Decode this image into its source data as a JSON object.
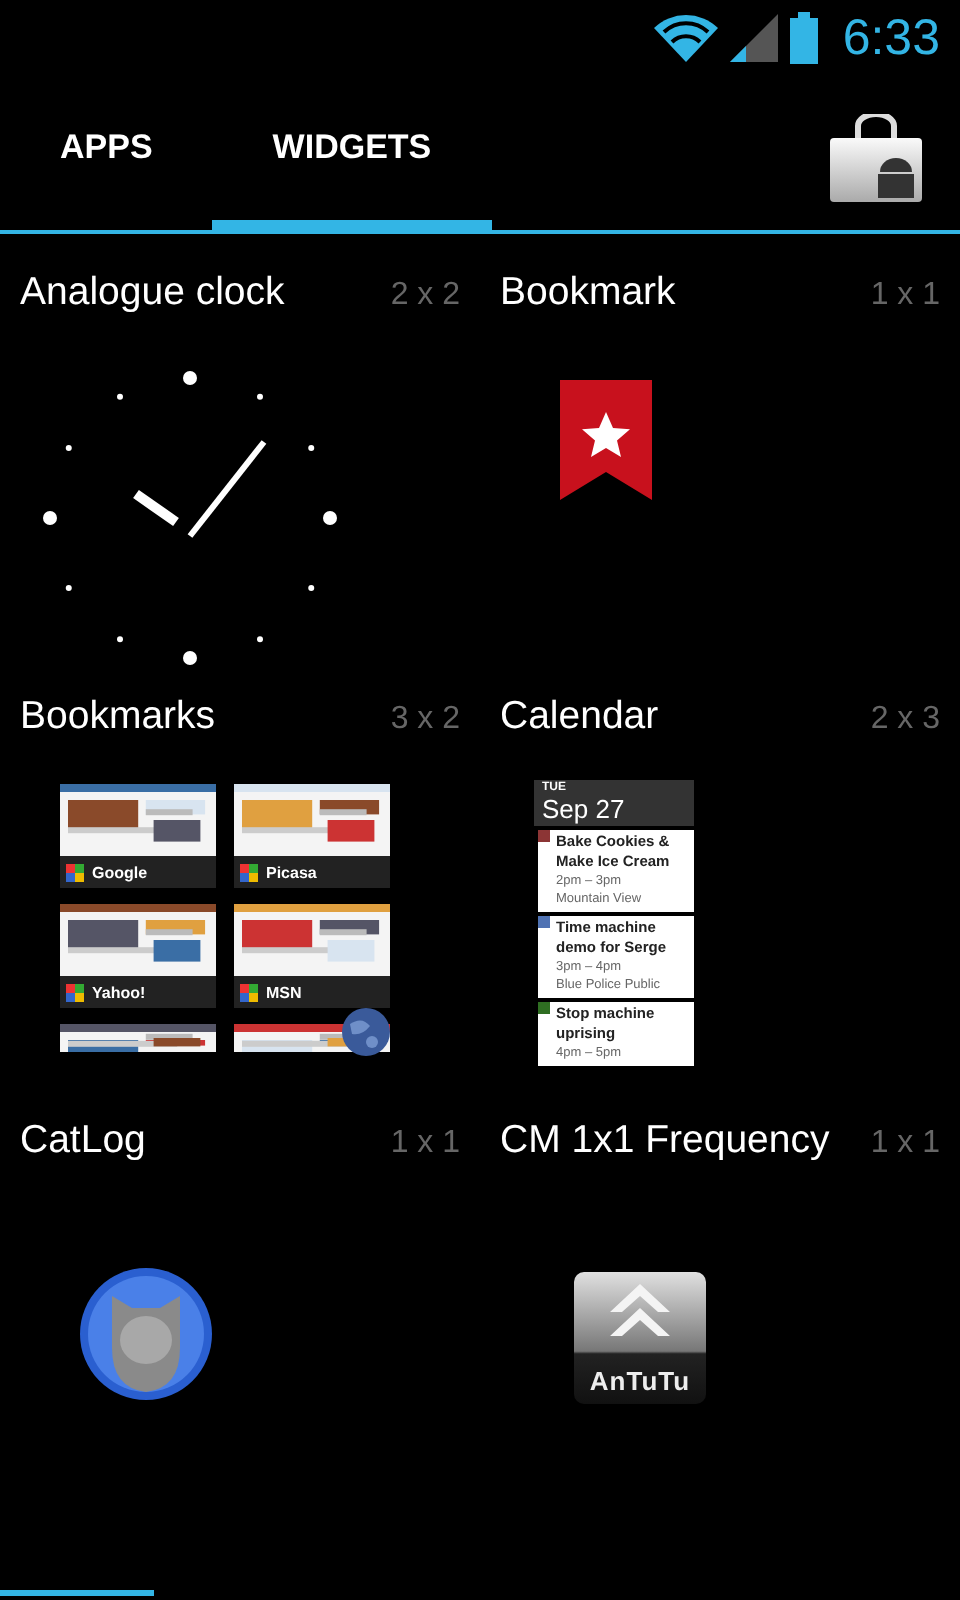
{
  "status_bar": {
    "time": "6:33"
  },
  "tabs": [
    {
      "label": "APPS",
      "selected": false
    },
    {
      "label": "WIDGETS",
      "selected": true
    }
  ],
  "widgets": [
    {
      "kind": "clock",
      "name": "Analogue clock",
      "size": "2 x 2"
    },
    {
      "kind": "bookmark",
      "name": "Bookmark",
      "size": "1 x 1"
    },
    {
      "kind": "bookmarks",
      "name": "Bookmarks",
      "size": "3 x 2",
      "items": [
        {
          "label": "Google"
        },
        {
          "label": "Picasa"
        },
        {
          "label": "Yahoo!"
        },
        {
          "label": "MSN"
        }
      ]
    },
    {
      "kind": "calendar",
      "name": "Calendar",
      "size": "2 x 3",
      "day": "TUE",
      "date": "Sep 27",
      "events": [
        {
          "title": "Bake Cookies & Make Ice Cream",
          "time": "2pm – 3pm",
          "place": "Mountain View",
          "color": "#8c3535"
        },
        {
          "title": "Time machine demo for Serge",
          "time": "3pm – 4pm",
          "place": "Blue Police Public",
          "color": "#4f72b3"
        },
        {
          "title": "Stop machine uprising",
          "time": "4pm – 5pm",
          "color": "#2f6e22"
        }
      ]
    },
    {
      "kind": "catlog",
      "name": "CatLog",
      "size": "1 x 1"
    },
    {
      "kind": "antutu",
      "name": "CM 1x1 Frequency",
      "size": "1 x 1",
      "logo": "AnTuTu"
    }
  ]
}
